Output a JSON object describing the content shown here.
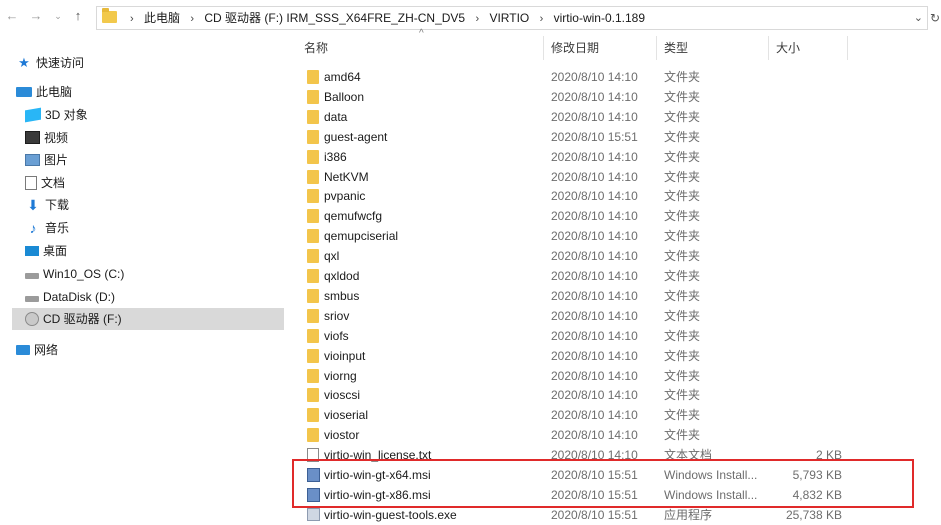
{
  "address_bar": {
    "back_icon": "arrow-left-icon",
    "forward_icon": "arrow-right-icon",
    "recent_icon": "chevron-down-icon",
    "up_icon": "arrow-up-icon",
    "crumbs": [
      "此电脑",
      "CD 驱动器 (F:) IRM_SSS_X64FRE_ZH-CN_DV5",
      "VIRTIO",
      "virtio-win-0.1.189"
    ]
  },
  "sidebar": {
    "items": [
      {
        "label": "快速访问",
        "icon": "star-icon"
      },
      {
        "label": "此电脑",
        "icon": "computer-icon"
      },
      {
        "label": "3D 对象",
        "icon": "3d-objects-icon"
      },
      {
        "label": "视频",
        "icon": "video-icon"
      },
      {
        "label": "图片",
        "icon": "pictures-icon"
      },
      {
        "label": "文档",
        "icon": "documents-icon"
      },
      {
        "label": "下载",
        "icon": "download-icon"
      },
      {
        "label": "音乐",
        "icon": "music-icon"
      },
      {
        "label": "桌面",
        "icon": "desktop-icon"
      },
      {
        "label": "Win10_OS (C:)",
        "icon": "drive-icon"
      },
      {
        "label": "DataDisk (D:)",
        "icon": "drive-icon"
      },
      {
        "label": "CD 驱动器 (F:)",
        "icon": "cd-drive-icon"
      },
      {
        "label": "网络",
        "icon": "network-icon"
      }
    ]
  },
  "columns": {
    "name": "名称",
    "date": "修改日期",
    "type": "类型",
    "size": "大小"
  },
  "files": [
    {
      "name": "amd64",
      "date": "2020/8/10 14:10",
      "type": "文件夹",
      "size": "",
      "icon": "folder-icon"
    },
    {
      "name": "Balloon",
      "date": "2020/8/10 14:10",
      "type": "文件夹",
      "size": "",
      "icon": "folder-icon"
    },
    {
      "name": "data",
      "date": "2020/8/10 14:10",
      "type": "文件夹",
      "size": "",
      "icon": "folder-icon"
    },
    {
      "name": "guest-agent",
      "date": "2020/8/10 15:51",
      "type": "文件夹",
      "size": "",
      "icon": "folder-icon"
    },
    {
      "name": "i386",
      "date": "2020/8/10 14:10",
      "type": "文件夹",
      "size": "",
      "icon": "folder-icon"
    },
    {
      "name": "NetKVM",
      "date": "2020/8/10 14:10",
      "type": "文件夹",
      "size": "",
      "icon": "folder-icon"
    },
    {
      "name": "pvpanic",
      "date": "2020/8/10 14:10",
      "type": "文件夹",
      "size": "",
      "icon": "folder-icon"
    },
    {
      "name": "qemufwcfg",
      "date": "2020/8/10 14:10",
      "type": "文件夹",
      "size": "",
      "icon": "folder-icon"
    },
    {
      "name": "qemupciserial",
      "date": "2020/8/10 14:10",
      "type": "文件夹",
      "size": "",
      "icon": "folder-icon"
    },
    {
      "name": "qxl",
      "date": "2020/8/10 14:10",
      "type": "文件夹",
      "size": "",
      "icon": "folder-icon"
    },
    {
      "name": "qxldod",
      "date": "2020/8/10 14:10",
      "type": "文件夹",
      "size": "",
      "icon": "folder-icon"
    },
    {
      "name": "smbus",
      "date": "2020/8/10 14:10",
      "type": "文件夹",
      "size": "",
      "icon": "folder-icon"
    },
    {
      "name": "sriov",
      "date": "2020/8/10 14:10",
      "type": "文件夹",
      "size": "",
      "icon": "folder-icon"
    },
    {
      "name": "viofs",
      "date": "2020/8/10 14:10",
      "type": "文件夹",
      "size": "",
      "icon": "folder-icon"
    },
    {
      "name": "vioinput",
      "date": "2020/8/10 14:10",
      "type": "文件夹",
      "size": "",
      "icon": "folder-icon"
    },
    {
      "name": "viorng",
      "date": "2020/8/10 14:10",
      "type": "文件夹",
      "size": "",
      "icon": "folder-icon"
    },
    {
      "name": "vioscsi",
      "date": "2020/8/10 14:10",
      "type": "文件夹",
      "size": "",
      "icon": "folder-icon"
    },
    {
      "name": "vioserial",
      "date": "2020/8/10 14:10",
      "type": "文件夹",
      "size": "",
      "icon": "folder-icon"
    },
    {
      "name": "viostor",
      "date": "2020/8/10 14:10",
      "type": "文件夹",
      "size": "",
      "icon": "folder-icon"
    },
    {
      "name": "virtio-win_license.txt",
      "date": "2020/8/10 14:10",
      "type": "文本文档",
      "size": "2 KB",
      "icon": "text-file-icon"
    },
    {
      "name": "virtio-win-gt-x64.msi",
      "date": "2020/8/10 15:51",
      "type": "Windows Install...",
      "size": "5,793 KB",
      "icon": "msi-installer-icon"
    },
    {
      "name": "virtio-win-gt-x86.msi",
      "date": "2020/8/10 15:51",
      "type": "Windows Install...",
      "size": "4,832 KB",
      "icon": "msi-installer-icon"
    },
    {
      "name": "virtio-win-guest-tools.exe",
      "date": "2020/8/10 15:51",
      "type": "应用程序",
      "size": "25,738 KB",
      "icon": "exe-icon"
    }
  ],
  "highlight_color": "#e02a2a"
}
